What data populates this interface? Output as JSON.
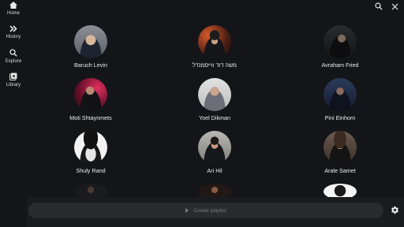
{
  "nav": {
    "items": [
      {
        "label": "Home",
        "icon": "home-icon"
      },
      {
        "label": "History",
        "icon": "history-icon"
      },
      {
        "label": "Explore",
        "icon": "search-icon"
      },
      {
        "label": "Library",
        "icon": "library-icon"
      }
    ]
  },
  "top_actions": {
    "search_icon": "search-icon",
    "close_icon": "close-icon"
  },
  "artists": [
    {
      "name": "Baruch Levin"
    },
    {
      "name": "משה דוד ווייסמנדל"
    },
    {
      "name": "Avraham Fried"
    },
    {
      "name": "Moti Shtaynmets"
    },
    {
      "name": "Yoel Dikman"
    },
    {
      "name": "Pini Einhorn"
    },
    {
      "name": "Shuly Rand"
    },
    {
      "name": "Ari Hil"
    },
    {
      "name": "Arale Samet"
    }
  ],
  "bottom": {
    "create_playlist_label": "Create playlist",
    "settings_icon": "gear-icon"
  }
}
